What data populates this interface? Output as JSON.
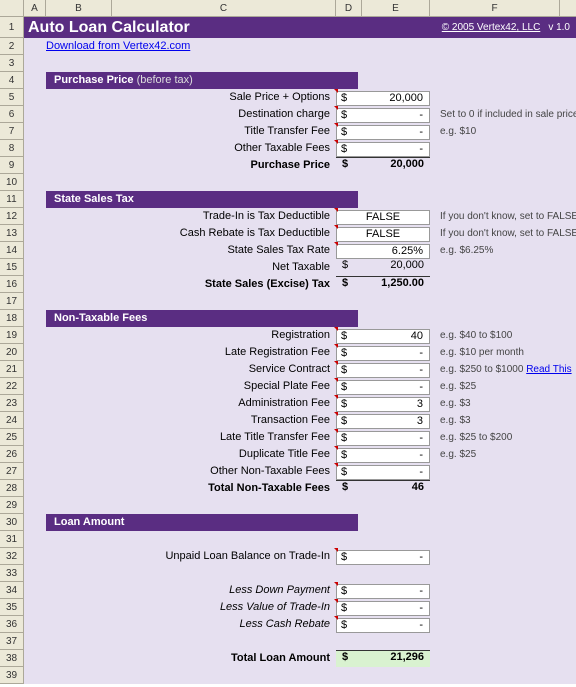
{
  "columns": [
    "A",
    "B",
    "C",
    "D",
    "E",
    "F"
  ],
  "rows": [
    "1",
    "2",
    "3",
    "4",
    "5",
    "6",
    "7",
    "8",
    "9",
    "10",
    "11",
    "12",
    "13",
    "14",
    "15",
    "16",
    "17",
    "18",
    "19",
    "20",
    "21",
    "22",
    "23",
    "24",
    "25",
    "26",
    "27",
    "28",
    "29",
    "30",
    "31",
    "32",
    "33",
    "34",
    "35",
    "36",
    "37",
    "38",
    "39"
  ],
  "title": {
    "main": "Auto Loan Calculator",
    "copyright": "© 2005 Vertex42, LLC",
    "version": "v 1.0"
  },
  "download_link": "Download from Vertex42.com",
  "sections": {
    "purchase": {
      "header": "Purchase Price",
      "header_note": "(before tax)"
    },
    "salestax": {
      "header": "State Sales Tax"
    },
    "nontax": {
      "header": "Non-Taxable Fees"
    },
    "loan": {
      "header": "Loan Amount"
    }
  },
  "purchase": {
    "rows": [
      {
        "label": "Sale Price + Options",
        "cur": "$",
        "val": "20,000",
        "hint": ""
      },
      {
        "label": "Destination charge",
        "cur": "$",
        "val": "-",
        "hint": "Set to 0 if included in sale price"
      },
      {
        "label": "Title Transfer Fee",
        "cur": "$",
        "val": "-",
        "hint": "e.g. $10"
      },
      {
        "label": "Other Taxable Fees",
        "cur": "$",
        "val": "-",
        "hint": ""
      }
    ],
    "total": {
      "label": "Purchase Price",
      "cur": "$",
      "val": "20,000"
    }
  },
  "salestax": {
    "rows": [
      {
        "label": "Trade-In is Tax Deductible",
        "val": "FALSE",
        "hint": "If you don't know, set to FALSE",
        "centered": true
      },
      {
        "label": "Cash Rebate is Tax Deductible",
        "val": "FALSE",
        "hint": "If you don't know, set to FALSE",
        "centered": true
      },
      {
        "label": "State Sales Tax Rate",
        "val": "6.25%",
        "hint": "e.g. $6.25%",
        "right": true
      }
    ],
    "net": {
      "label": "Net Taxable",
      "cur": "$",
      "val": "20,000"
    },
    "total": {
      "label": "State Sales (Excise) Tax",
      "cur": "$",
      "val": "1,250.00"
    }
  },
  "nontax": {
    "rows": [
      {
        "label": "Registration",
        "cur": "$",
        "val": "40",
        "hint": "e.g. $40 to $100"
      },
      {
        "label": "Late Registration Fee",
        "cur": "$",
        "val": "-",
        "hint": "e.g. $10 per month"
      },
      {
        "label": "Service Contract",
        "cur": "$",
        "val": "-",
        "hint": "e.g. $250 to $1000",
        "link": "Read This"
      },
      {
        "label": "Special Plate Fee",
        "cur": "$",
        "val": "-",
        "hint": "e.g. $25"
      },
      {
        "label": "Administration Fee",
        "cur": "$",
        "val": "3",
        "hint": "e.g. $3"
      },
      {
        "label": "Transaction Fee",
        "cur": "$",
        "val": "3",
        "hint": "e.g. $3"
      },
      {
        "label": "Late Title Transfer Fee",
        "cur": "$",
        "val": "-",
        "hint": "e.g. $25 to $200"
      },
      {
        "label": "Duplicate Title Fee",
        "cur": "$",
        "val": "-",
        "hint": "e.g. $25"
      },
      {
        "label": "Other Non-Taxable Fees",
        "cur": "$",
        "val": "-",
        "hint": ""
      }
    ],
    "total": {
      "label": "Total Non-Taxable Fees",
      "cur": "$",
      "val": "46"
    }
  },
  "loan": {
    "unpaid": {
      "label": "Unpaid Loan Balance on Trade-In",
      "cur": "$",
      "val": "-"
    },
    "less": [
      {
        "label": "Less Down Payment",
        "cur": "$",
        "val": "-"
      },
      {
        "label": "Less Value of Trade-In",
        "cur": "$",
        "val": "-"
      },
      {
        "label": "Less Cash Rebate",
        "cur": "$",
        "val": "-"
      }
    ],
    "total": {
      "label": "Total Loan Amount",
      "cur": "$",
      "val": "21,296"
    }
  }
}
